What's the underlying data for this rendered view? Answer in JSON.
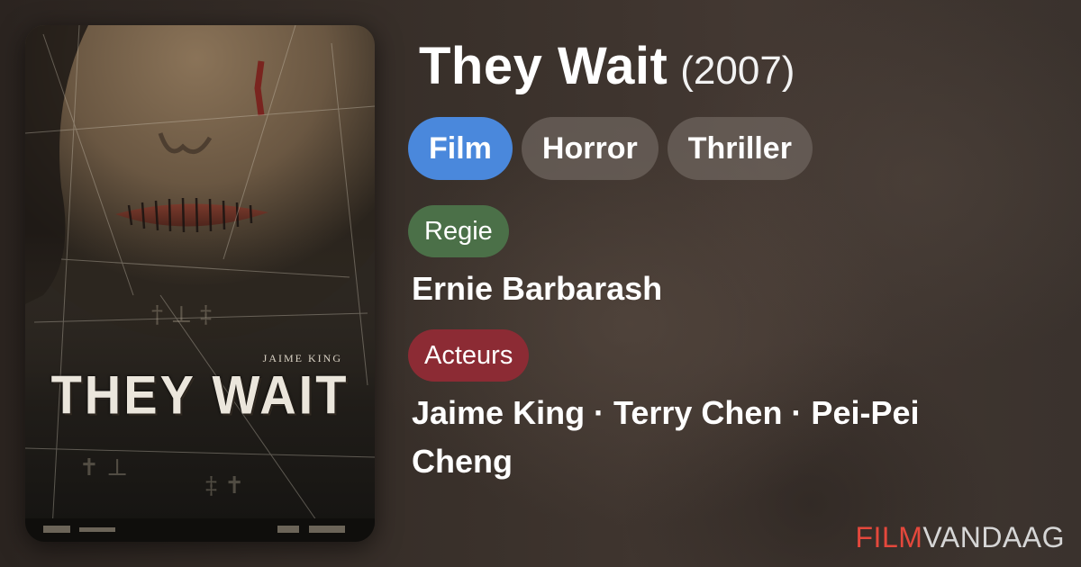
{
  "poster": {
    "actor_credit": "JAIME KING",
    "title_text": "THEY WAIT"
  },
  "movie": {
    "title": "They Wait",
    "year": "(2007)"
  },
  "tags": [
    "Film",
    "Horror",
    "Thriller"
  ],
  "director_section": {
    "label": "Regie",
    "value": "Ernie Barbarash"
  },
  "actors_section": {
    "label": "Acteurs",
    "value": "Jaime King · Terry Chen · Pei-Pei Cheng"
  },
  "brand": {
    "part1": "FILM",
    "part2": "VANDAAG"
  },
  "colors": {
    "tag_film": "#4a88dc",
    "tag_genre": "#6e645e",
    "label_regie": "#4b7048",
    "label_acteurs": "#8c2b34",
    "brand_red": "#e4483c"
  }
}
